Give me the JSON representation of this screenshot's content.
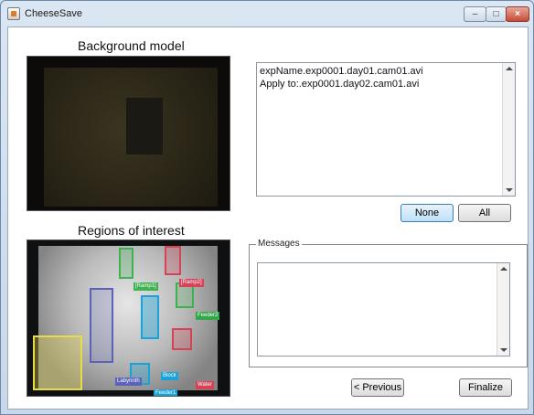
{
  "window": {
    "title": "CheeseSave"
  },
  "panels": {
    "background_title": "Background model",
    "roi_title": "Regions of interest"
  },
  "rois": [
    {
      "id": "ramp1",
      "label": "[Ramp1]",
      "color": "#3db24f"
    },
    {
      "id": "ramp2",
      "label": "[Ramp2]",
      "color": "#d64357"
    },
    {
      "id": "feeder2",
      "label": "Feeder2",
      "color": "#36a64d"
    },
    {
      "id": "labyrinth",
      "label": "Labyrinth",
      "color": "#5a63b8"
    },
    {
      "id": "block",
      "label": "Block",
      "color": "#1aa3d8"
    },
    {
      "id": "water",
      "label": "Water",
      "color": "#d64357"
    },
    {
      "id": "feeder1",
      "label": "Feeder1",
      "color": "#1aa3d8"
    },
    {
      "id": "start",
      "label": "",
      "color": "#e8db4a"
    }
  ],
  "file_list": {
    "items": [
      "expName.exp0001.day01.cam01.avi",
      "Apply to:.exp0001.day02.cam01.avi"
    ]
  },
  "buttons": {
    "none": "None",
    "all": "All",
    "previous": "< Previous",
    "finalize": "Finalize"
  },
  "messages": {
    "label": "Messages",
    "text": ""
  }
}
